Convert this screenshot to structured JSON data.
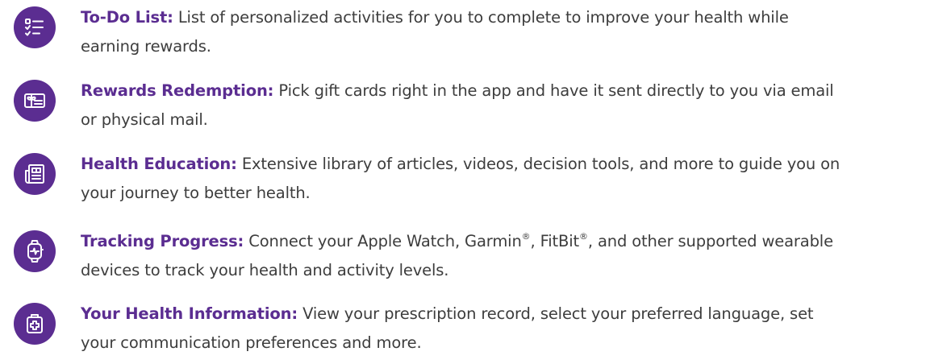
{
  "features": [
    {
      "icon": "checklist-icon",
      "title": "To-Do List",
      "lines": [
        "List of personalized activities for you to complete to improve your health while",
        "earning rewards."
      ]
    },
    {
      "icon": "gift-card-icon",
      "title": "Rewards Redemption",
      "lines": [
        "Pick gift cards right in the app and have it sent directly to you via email",
        "or physical mail."
      ]
    },
    {
      "icon": "newspaper-icon",
      "title": "Health Education",
      "lines": [
        "Extensive library of articles, videos, decision tools, and more to guide you on",
        "your journey to better health."
      ]
    },
    {
      "icon": "smartwatch-icon",
      "title": "Tracking Progress",
      "line1_parts": [
        "Connect your Apple Watch, Garmin",
        "®",
        ", FitBit",
        "®",
        ", and other supported wearable"
      ],
      "lines": [
        "",
        "devices to track your health and activity levels."
      ]
    },
    {
      "icon": "medical-kit-icon",
      "title": "Your Health Information",
      "lines": [
        "View your prescription record, select your preferred language, set",
        "your communication preferences and more."
      ]
    }
  ],
  "separator": ":",
  "colors": {
    "accent": "#5b2d91",
    "text": "#3d3d3d"
  }
}
